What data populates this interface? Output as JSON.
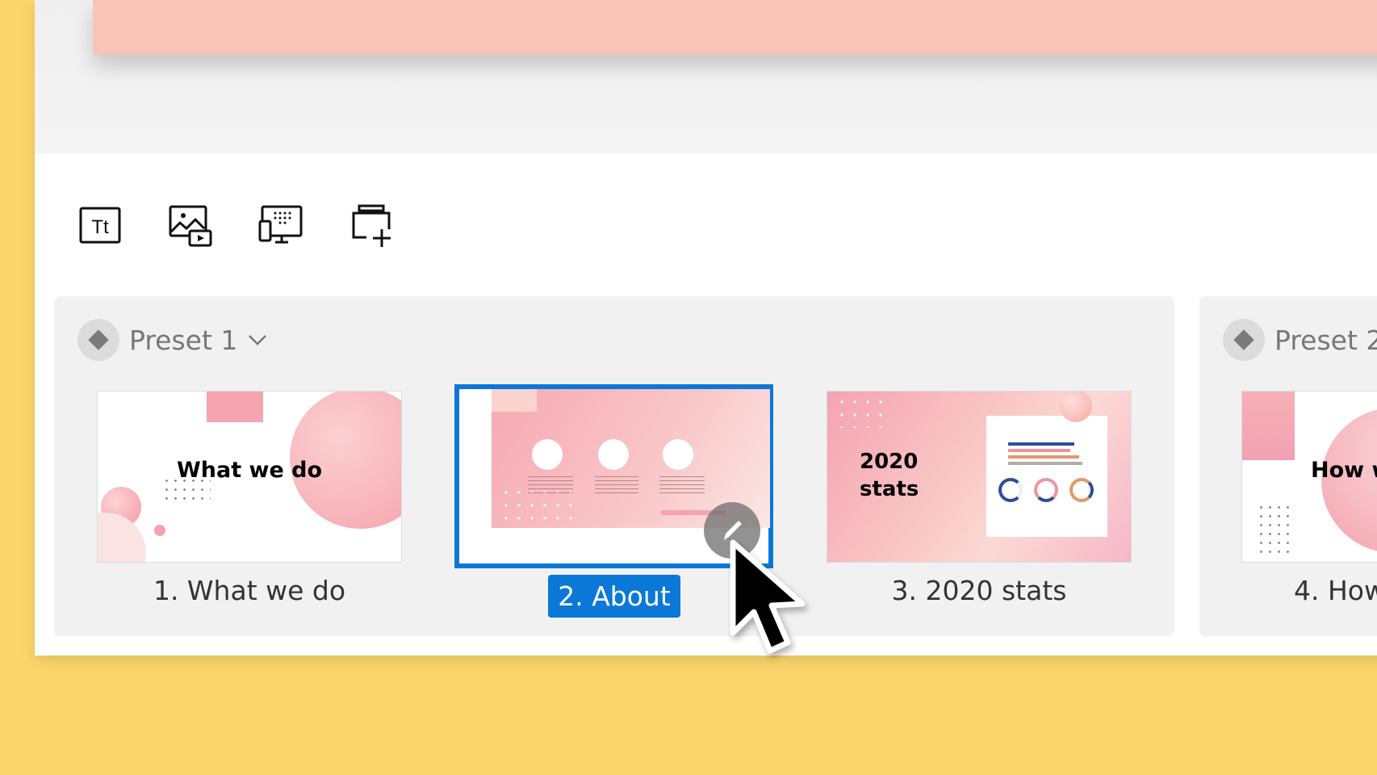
{
  "toolbar": {
    "items": [
      {
        "icon": "text-icon",
        "label": "Tt"
      },
      {
        "icon": "media-icon"
      },
      {
        "icon": "device-layout-icon"
      },
      {
        "icon": "add-slide-icon"
      }
    ]
  },
  "groups": [
    {
      "name": "Preset 1",
      "slides": [
        {
          "label": "1. What we do",
          "title": "What we do"
        },
        {
          "label": "2. About",
          "selected": true
        },
        {
          "label": "3. 2020 stats",
          "title_line1": "2020",
          "title_line2": "stats"
        }
      ]
    },
    {
      "name": "Preset 2",
      "slides": [
        {
          "label": "4. How",
          "title": "How we"
        }
      ]
    }
  ],
  "colors": {
    "background": "#fdd66b",
    "accent": "#0a78d7",
    "slide_pink": "#fac3b8"
  }
}
